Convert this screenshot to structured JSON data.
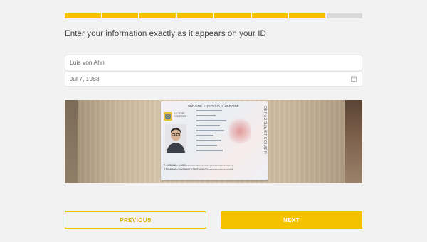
{
  "progress": {
    "completed_steps": 7,
    "total_steps": 8,
    "fill_color": "#f5c200",
    "track_color": "#d9d9d9"
  },
  "heading": "Enter your information exactly as it appears on your ID",
  "form": {
    "name_value": "Luis von Ahn",
    "date_value": "Jul 7, 1983",
    "date_icon": "calendar-icon"
  },
  "id_photo": {
    "header": "UKRAINE ✦ УКРАЇНА ✦ UKRAINE",
    "issuer_label": "ПАСПОРТ\nPASSPORT",
    "specimen": "ОБРАЗЕЦЬ/SPECIMEN",
    "mrz_line1": "P<UKRAHN<<LUIS<<<<<<<<<<<<<<<<<<<<<<<<<<<<<<",
    "mrz_line2": "ZZ000000<7UKR8307071M2109022<<<<<<<<<<<<<<06"
  },
  "buttons": {
    "previous": "PREVIOUS",
    "next": "NEXT"
  }
}
